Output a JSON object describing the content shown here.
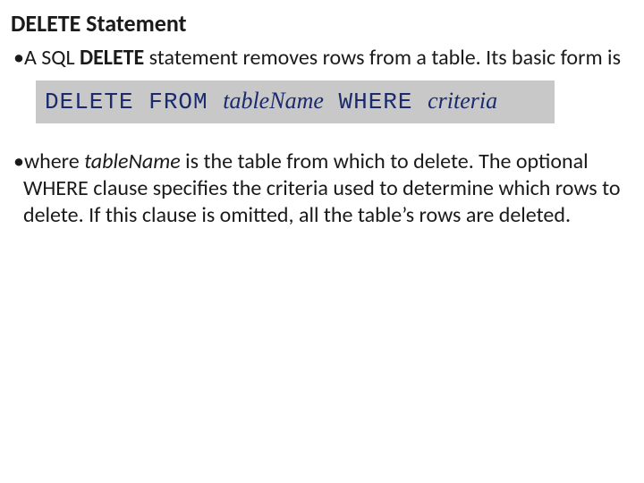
{
  "title": "DELETE Statement",
  "bullet1": {
    "pre": "A SQL ",
    "bold": "DELETE",
    "post": " statement removes rows from a table. Its basic form is"
  },
  "code": {
    "kw1": "DELETE FROM ",
    "arg1": "tableName",
    "kw2": " WHERE ",
    "arg2": "criteria"
  },
  "bullet2": {
    "pre": "where ",
    "italic": "tableName",
    "post": " is the table from which to delete. The optional WHERE clause specifies the criteria used to determine which rows to delete. If this clause is omitted, all the table’s rows are deleted."
  }
}
